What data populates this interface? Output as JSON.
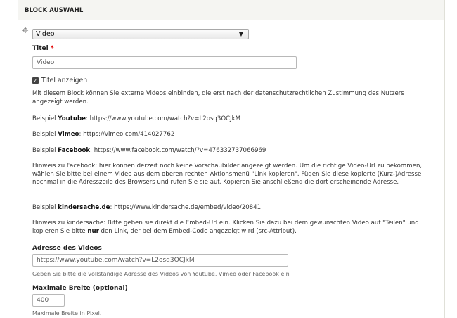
{
  "panel": {
    "title": "BLOCK AUSWAHL"
  },
  "block_type": {
    "selected": "Video"
  },
  "title_field": {
    "label": "Titel",
    "required_marker": "*",
    "value": "Video"
  },
  "show_title": {
    "label": "Titel anzeigen",
    "checked": true
  },
  "info": {
    "intro": "Mit diesem Block können Sie externe Videos einbinden, die erst nach der datenschutzrechtlichen Zustimmung des Nutzers angezeigt werden.",
    "youtube": {
      "prefix": "Beispiel ",
      "name": "Youtube",
      "url": ": https://www.youtube.com/watch?v=L2osq3OCJkM"
    },
    "vimeo": {
      "prefix": "Beispiel ",
      "name": "Vimeo",
      "url": ": https://vimeo.com/414027762"
    },
    "facebook": {
      "prefix": "Beispiel ",
      "name": "Facebook",
      "url": ": https://www.facebook.com/watch/?v=476332737066969"
    },
    "facebook_hint": "Hinweis zu Facebook: hier können derzeit noch keine Vorschaubilder angezeigt werden. Um die richtige Video-Url zu bekommen, wählen Sie bitte bei einem Video aus dem oberen rechten Aktionsmenü \"Link kopieren\". Fügen Sie diese kopierte (Kurz-)Adresse nochmal in die Adresszeile des Browsers und rufen Sie sie auf. Kopieren Sie anschließend die dort erscheinende Adresse.",
    "kindersache": {
      "prefix": "Beispiel ",
      "name": "kindersache.de",
      "url": ": https://www.kindersache.de/embed/video/20841"
    },
    "kindersache_hint": {
      "part1": "Hinweis zu kindersache: Bitte geben sie direkt die Embed-Url ein. Klicken Sie dazu bei dem gewünschten Video auf \"Teilen\" und kopieren Sie bitte ",
      "bold": "nur",
      "part2": " den Link, der bei dem Embed-Code angezeigt wird (src-Attribut)."
    }
  },
  "video_url": {
    "label": "Adresse des Videos",
    "value": "https://www.youtube.com/watch?v=L2osq3OCJkM",
    "description": "Geben Sie bitte die vollständige Adresse des Videos von Youtube, Vimeo oder Facebook ein"
  },
  "max_width": {
    "label": "Maximale Breite (optional)",
    "value": "400",
    "description": "Maximale Breite in Pixel."
  },
  "icons": {
    "drag": "move-arrows-icon",
    "select_arrow": "triangle-down-icon",
    "checkbox": "checkmark-icon"
  }
}
